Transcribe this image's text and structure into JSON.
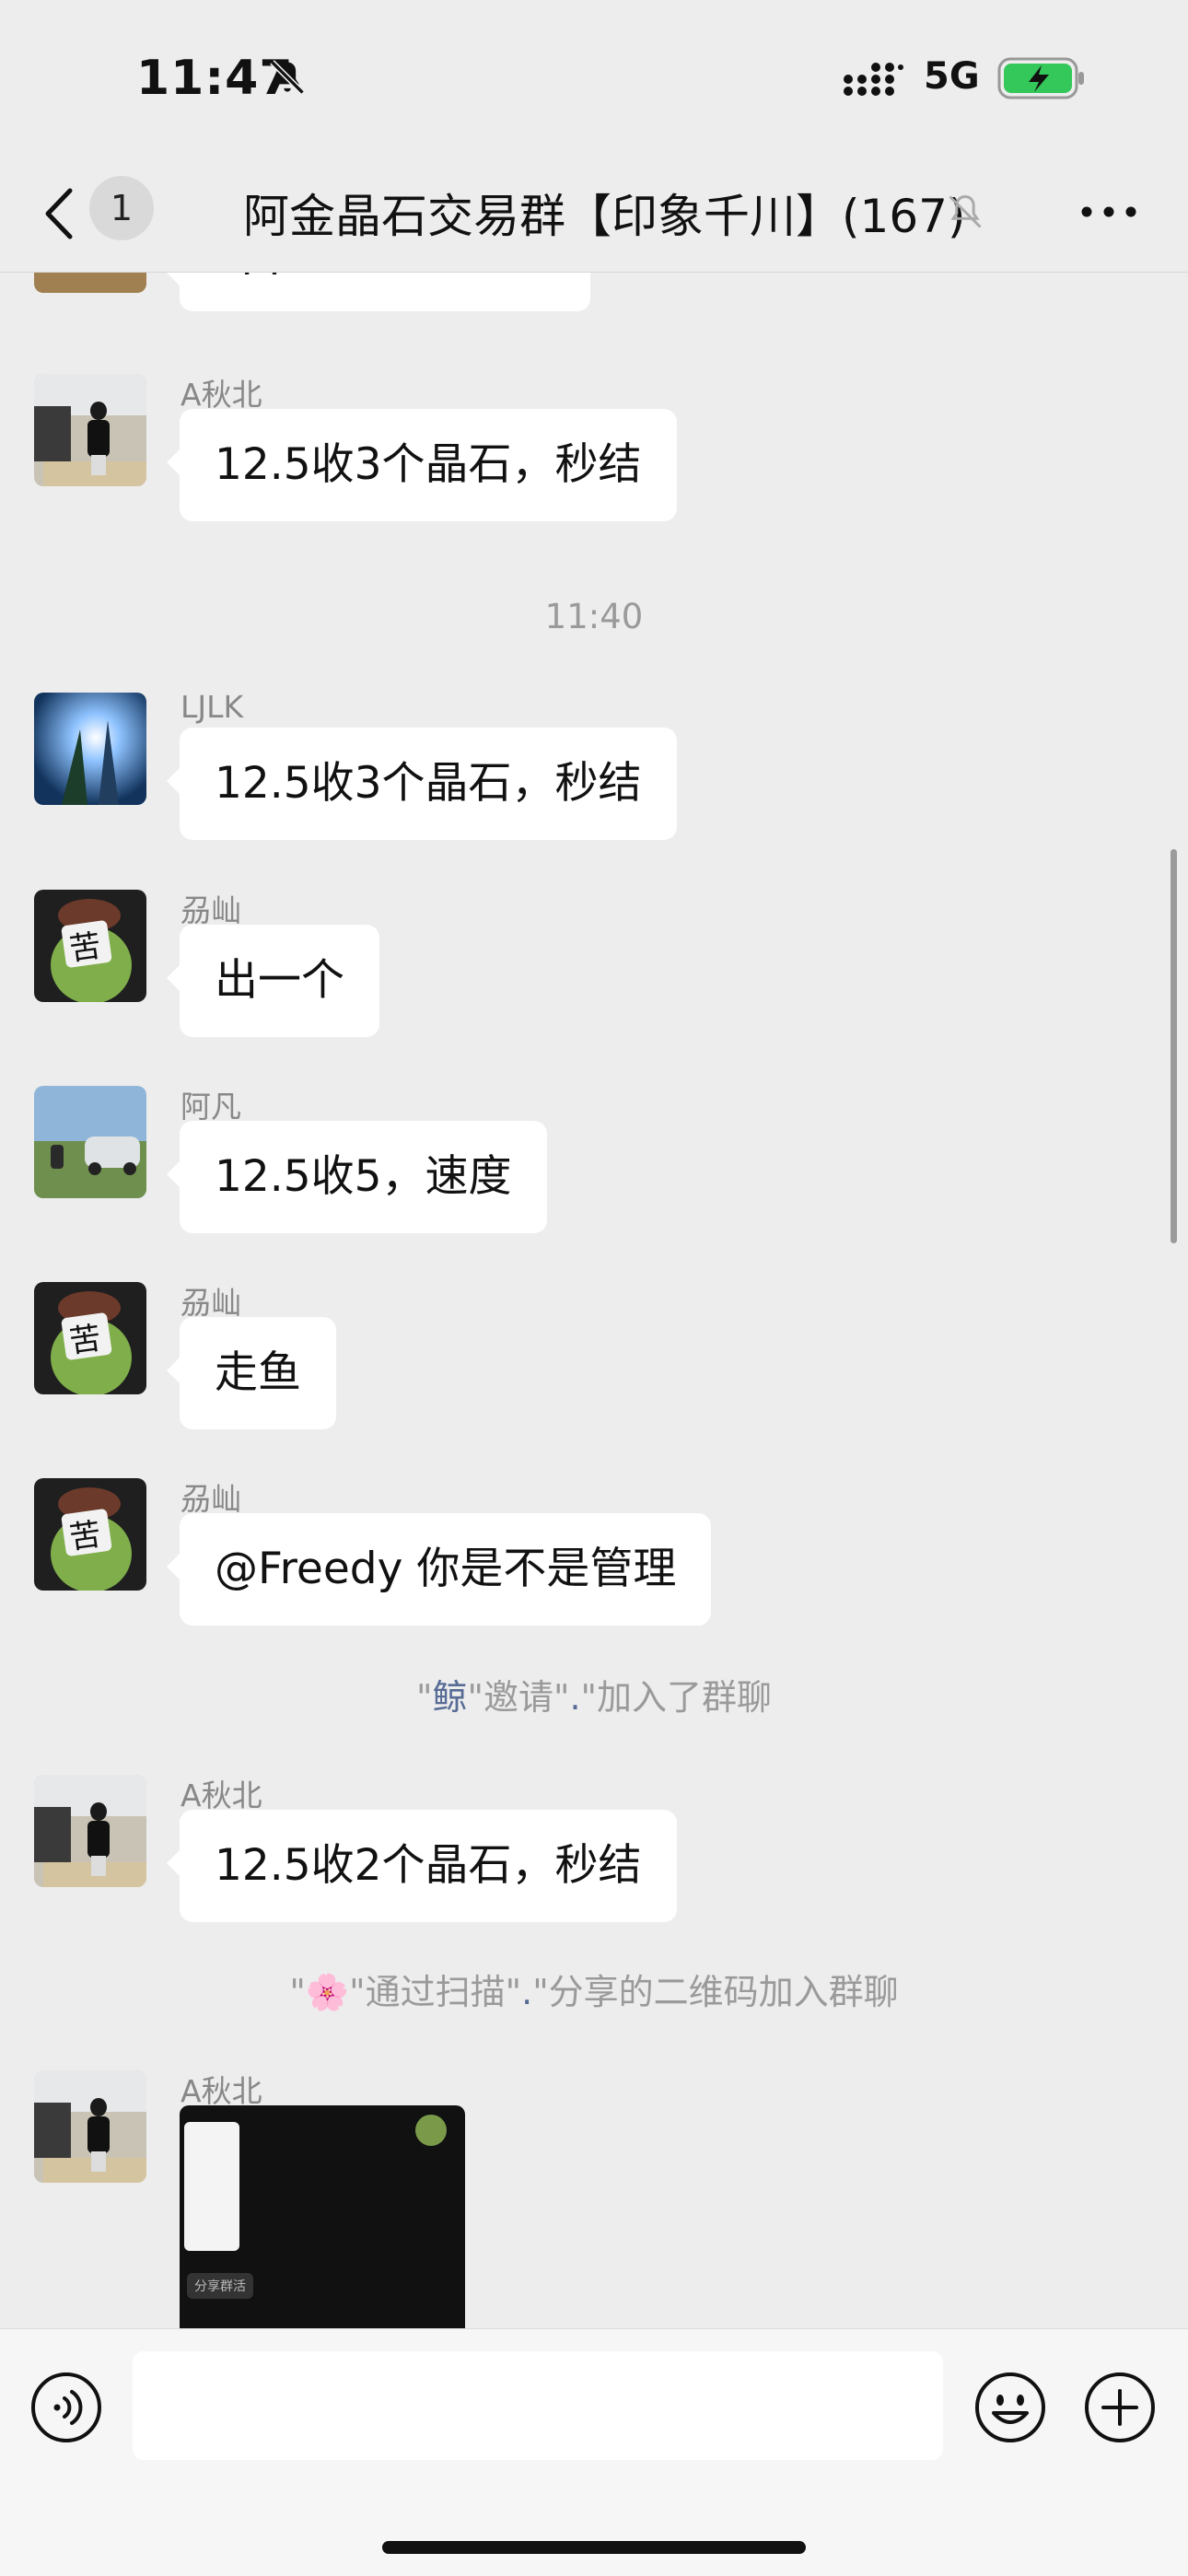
{
  "status_bar": {
    "time": "11:47",
    "network": "5G",
    "icons": [
      "bell-slash-icon",
      "signal-icon",
      "battery-charging-icon"
    ]
  },
  "nav": {
    "back_icon": "chevron-left-icon",
    "unread_count": "1",
    "title": "阿金晶石交易群【印象千川】(167)",
    "muted_icon": "bell-slash-icon",
    "more_icon": "more-horizontal-icon"
  },
  "messages": {
    "partial_top": {
      "text": "app啥时候上线呀"
    },
    "m1": {
      "sender": "A秋北",
      "text": "12.5收3个晶石，秒结"
    },
    "time_divider": "11:40",
    "m2": {
      "sender": "LJLK",
      "text": "12.5收3个晶石，秒结"
    },
    "m3": {
      "sender": "刕屾",
      "text": "出一个"
    },
    "m4": {
      "sender": "阿凡",
      "text": "12.5收5，速度"
    },
    "m5": {
      "sender": "刕屾",
      "text": "走鱼"
    },
    "m6": {
      "sender": "刕屾",
      "text": "@Freedy 你是不是管理"
    },
    "sys1": {
      "q1": "\"",
      "name": "鲸",
      "mid": "\"邀请\"",
      "name2": ".",
      "end": "\"加入了群聊"
    },
    "m7": {
      "sender": "A秋北",
      "text": "12.5收2个晶石，秒结"
    },
    "sys2": {
      "q1": "\"",
      "name": "🌸",
      "mid": "\"通过扫描\"",
      "name2": ".",
      "end": "\"分享的二维码加入群聊"
    },
    "m8": {
      "sender": "A秋北",
      "image_label": "分享群活"
    }
  },
  "input_bar": {
    "placeholder": "",
    "icons": [
      "voice-icon",
      "emoji-icon",
      "plus-icon"
    ]
  }
}
